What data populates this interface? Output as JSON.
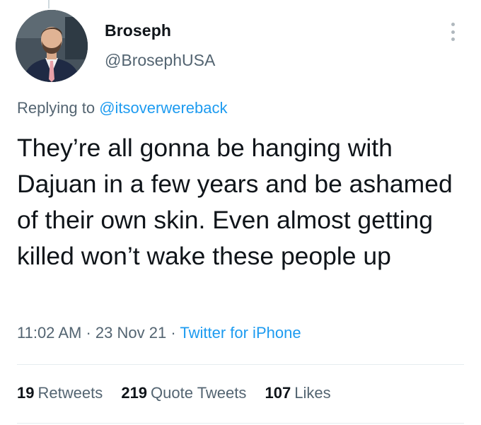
{
  "tweet": {
    "author": {
      "display_name": "Broseph",
      "handle": "@BrosephUSA"
    },
    "replying_prefix": "Replying to",
    "replying_to": "@itsoverwereback",
    "text": "They’re all gonna be hanging with Dajuan in a few years and be ashamed of their own skin. Even almost getting killed won’t wake these people up",
    "time": "11:02 AM",
    "date": "23 Nov 21",
    "source": "Twitter for iPhone",
    "separator": "·"
  },
  "stats": {
    "retweets_count": "19",
    "retweets_label": "Retweets",
    "quotes_count": "219",
    "quotes_label": "Quote Tweets",
    "likes_count": "107",
    "likes_label": "Likes"
  },
  "icons": {
    "more": "more-vertical-icon"
  },
  "colors": {
    "link": "#1d9bf0",
    "secondary_text": "#536471",
    "primary_text": "#0f1419",
    "divider": "#e6ecf0"
  }
}
